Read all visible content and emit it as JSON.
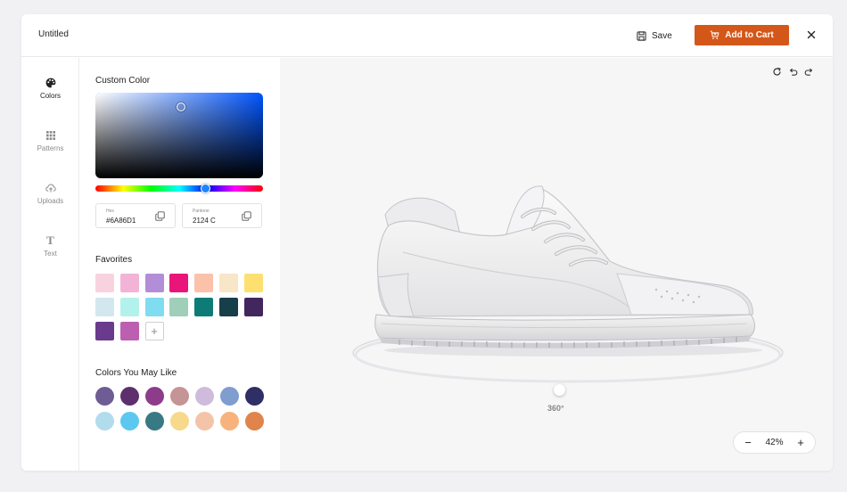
{
  "header": {
    "title": "Untitled",
    "save_label": "Save",
    "cart_label": "Add to Cart"
  },
  "sidebar": {
    "items": [
      {
        "label": "Colors",
        "icon": "palette-icon",
        "active": true
      },
      {
        "label": "Patterns",
        "icon": "grid-icon",
        "active": false
      },
      {
        "label": "Uploads",
        "icon": "upload-icon",
        "active": false
      },
      {
        "label": "Text",
        "icon": "text-icon",
        "active": false
      }
    ]
  },
  "custom_color": {
    "title": "Custom Color",
    "hue_color": "#0055ff",
    "hex_label": "Hex",
    "hex_value": "#6A86D1",
    "pantone_label": "Pantone",
    "pantone_value": "2124 C"
  },
  "favorites": {
    "title": "Favorites",
    "colors": [
      "#f8d3df",
      "#f2b3d6",
      "#b28ed8",
      "#e9157a",
      "#fbc1aa",
      "#f8e6c8",
      "#fde06f",
      "#d3e7ef",
      "#b3f2ec",
      "#7fdcf1",
      "#9fcfb8",
      "#0d7c77",
      "#173f4a",
      "#42275f",
      "#6a3a8c",
      "#bc5fb1"
    ],
    "add_label": "+"
  },
  "suggested": {
    "title": "Colors You May Like",
    "colors": [
      "#6e5c95",
      "#5e2f6d",
      "#8d3c8c",
      "#c59495",
      "#cfbcdc",
      "#7f9dcf",
      "#2f2f66",
      "#b1dcec",
      "#5cc8ef",
      "#377a84",
      "#f6d98a",
      "#f3c4a8",
      "#f8b27e",
      "#e1844b"
    ]
  },
  "stage": {
    "rotation_label": "360°",
    "zoom_value": "42%",
    "zoom_out": "−",
    "zoom_in": "+"
  }
}
